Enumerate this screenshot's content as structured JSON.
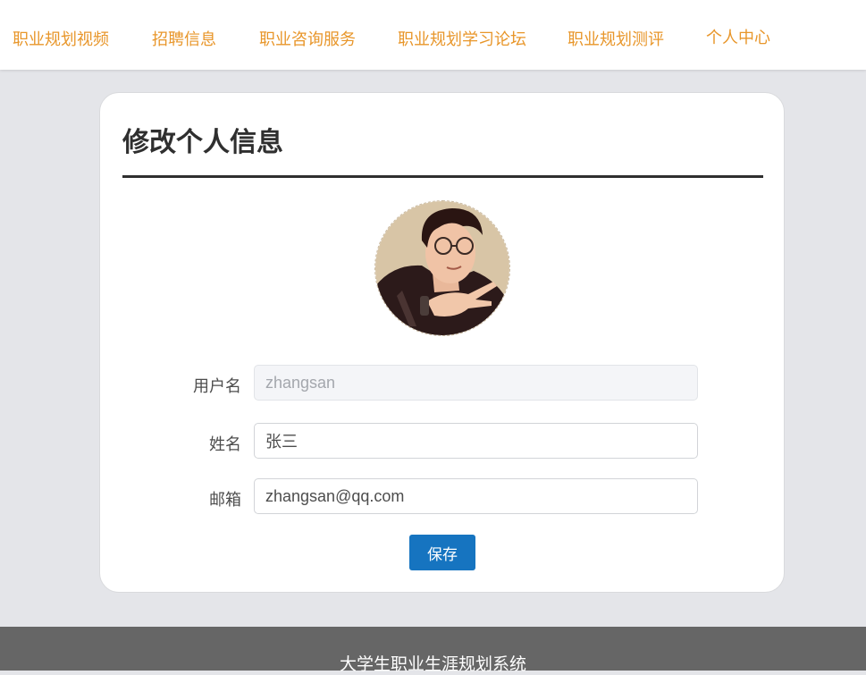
{
  "nav": {
    "items": [
      {
        "label": "职业规划视频"
      },
      {
        "label": "招聘信息"
      },
      {
        "label": "职业咨询服务"
      },
      {
        "label": "职业规划学习论坛"
      },
      {
        "label": "职业规划测评"
      },
      {
        "label": "个人中心"
      }
    ]
  },
  "card": {
    "title": "修改个人信息",
    "form": {
      "username_label": "用户名",
      "username_value": "zhangsan",
      "name_label": "姓名",
      "name_value": "张三",
      "email_label": "邮箱",
      "email_value": "zhangsan@qq.com",
      "save_label": "保存"
    }
  },
  "footer": {
    "text": "大学生职业生涯规划系统"
  },
  "colors": {
    "nav_text": "#e8962a",
    "primary_button": "#1674c0",
    "page_background": "#e4e5e9",
    "footer_background": "#666666"
  }
}
